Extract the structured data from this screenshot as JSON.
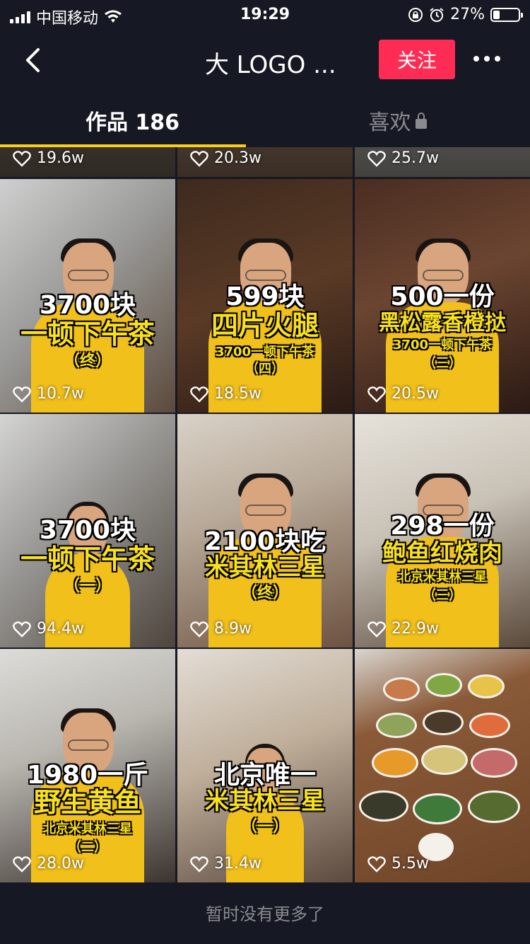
{
  "status_bar": {
    "carrier": "中国移动",
    "time": "19:29",
    "battery": "27%",
    "battery_level": 0.27
  },
  "nav": {
    "title": "大 LOGO ...",
    "follow_label": "关注"
  },
  "tabs": [
    {
      "label": "作品 186"
    },
    {
      "label": "喜欢"
    }
  ],
  "videos": [
    {
      "likes": "19.6w"
    },
    {
      "likes": "20.3w"
    },
    {
      "likes": "25.7w"
    },
    {
      "title": "3700块",
      "subtitle": "一顿下午茶",
      "note": "（终）",
      "likes": "10.7w"
    },
    {
      "title": "599块",
      "subtitle": "四片火腿",
      "note": "3700一顿下午茶",
      "note2": "（四）",
      "likes": "18.5w"
    },
    {
      "title": "500一份",
      "subtitle": "黑松露香橙挞",
      "note": "3700一顿下午茶",
      "note2": "（三）",
      "likes": "20.5w"
    },
    {
      "title": "3700块",
      "subtitle": "一顿下午茶",
      "note": "（一）",
      "likes": "94.4w"
    },
    {
      "title": "2100块吃",
      "subtitle": "米其林三星",
      "note": "（终）",
      "likes": "8.9w"
    },
    {
      "title": "298一份",
      "subtitle": "鲍鱼红烧肉",
      "note": "北京米其林三星",
      "note2": "（三）",
      "likes": "22.9w"
    },
    {
      "title": "1980一斤",
      "subtitle": "野生黄鱼",
      "note": "北京米其林三星",
      "note2": "（二）",
      "likes": "28.0w"
    },
    {
      "title": "北京唯一",
      "subtitle": "米其林三星",
      "note": "（一）",
      "likes": "31.4w"
    },
    {
      "likes": "5.5w"
    }
  ],
  "footer": "暂时没有更多了",
  "colors": {
    "background": "#161823",
    "follow_button": "#fe2c55",
    "tab_indicator": "#face15",
    "caption_yellow": "#f8e01d"
  }
}
